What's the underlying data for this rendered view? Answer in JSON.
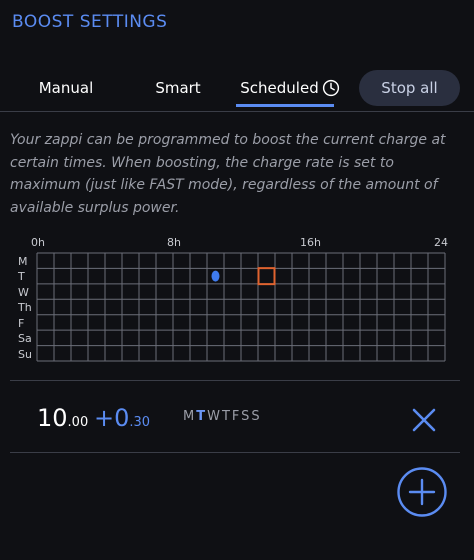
{
  "header": {
    "title": "BOOST SETTINGS"
  },
  "tabs": [
    {
      "label": "Manual"
    },
    {
      "label": "Smart"
    },
    {
      "label": "Scheduled"
    }
  ],
  "stop_all_label": "Stop all",
  "description": "Your zappi can be programmed to boost the current charge at certain times. When boosting, the charge rate is set to maximum (just like FAST mode), regardless of the amount of available surplus power.",
  "grid": {
    "hour_labels": [
      "0h",
      "8h",
      "16h",
      "24"
    ],
    "day_labels": [
      "M",
      "T",
      "W",
      "Th",
      "F",
      "Sa",
      "Su"
    ],
    "marker_dot": {
      "day": "T",
      "hour": 10.5
    },
    "marker_square": {
      "day": "T",
      "hour": 13.5
    }
  },
  "schedule": {
    "start_hour": "10",
    "start_min": ".00",
    "duration_plus": "+",
    "duration_hour": "0",
    "duration_min": ".30",
    "days": [
      {
        "label": "M",
        "active": false
      },
      {
        "label": "T",
        "active": true
      },
      {
        "label": "W",
        "active": false
      },
      {
        "label": "T",
        "active": false
      },
      {
        "label": "F",
        "active": false
      },
      {
        "label": "S",
        "active": false
      },
      {
        "label": "S",
        "active": false
      }
    ]
  },
  "colors": {
    "accent": "#5b8cf2",
    "marker_square": "#e0632f",
    "marker_dot": "#3f7cf0"
  },
  "icons": {
    "tab_scheduled": "clock-icon",
    "delete": "close-icon",
    "add": "plus-circle-icon"
  }
}
